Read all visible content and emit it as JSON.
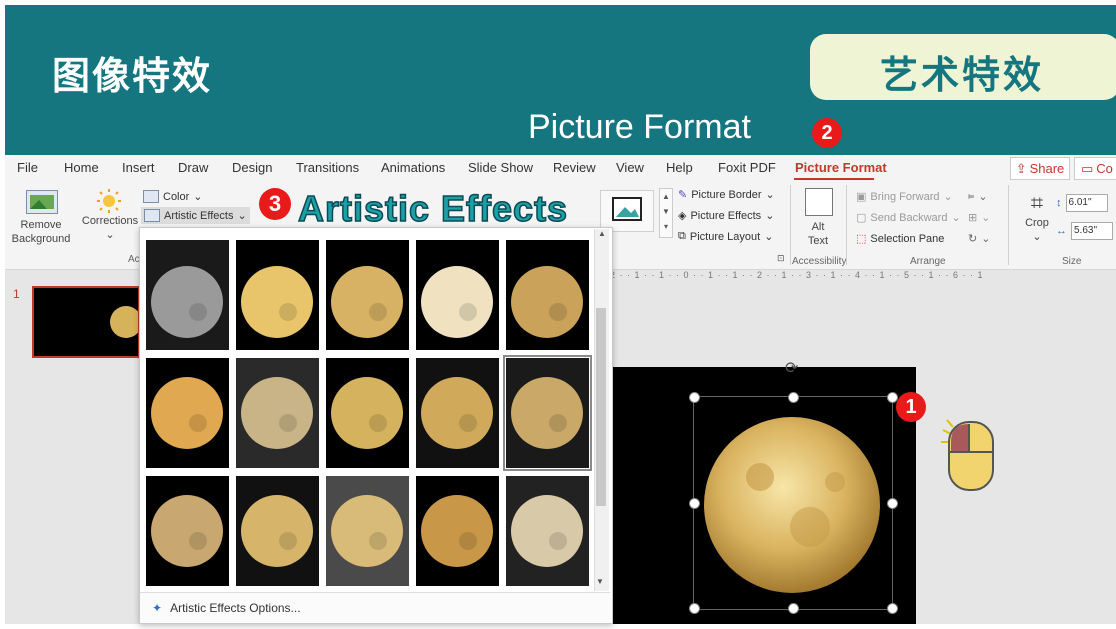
{
  "banner": {
    "left_title": "图像特效",
    "right_title": "艺术特效",
    "caption": "Picture Format",
    "badges": [
      "1",
      "2",
      "3"
    ],
    "callout": "Artistic Effects"
  },
  "tabs": [
    "File",
    "Home",
    "Insert",
    "Draw",
    "Design",
    "Transitions",
    "Animations",
    "Slide Show",
    "Review",
    "View",
    "Help",
    "Foxit PDF",
    "Picture Format"
  ],
  "active_tab": "Picture Format",
  "share_label": "Share",
  "comments_label": "Co",
  "ribbon": {
    "remove_bg": [
      "Remove",
      "Background"
    ],
    "corrections": "Corrections",
    "color": "Color",
    "artistic_effects": "Artistic Effects",
    "group_adjust_partial": "Ac",
    "picture_border": "Picture Border",
    "picture_effects": "Picture Effects",
    "picture_layout": "Picture Layout",
    "alt_text": [
      "Alt",
      "Text"
    ],
    "accessibility": "Accessibility",
    "bring_forward": "Bring Forward",
    "send_backward": "Send Backward",
    "selection_pane": "Selection Pane",
    "arrange": "Arrange",
    "crop": "Crop",
    "height": "6.01\"",
    "width": "5.63\"",
    "size": "Size"
  },
  "thumbnail_number": "1",
  "ruler_text": "2 · · 1 · · 1 · · 0 · · 1 · · 1 · · 2 · · 1 · · 3 · · 1 · · 4 · · 1 · · 5 · · 1 · · 6 · · 1",
  "gallery": {
    "options_label": "Artistic Effects Options..."
  },
  "colors": {
    "banner": "#157680",
    "accent_red": "#e81a1a",
    "picture_format_tab": "#c0392b"
  }
}
